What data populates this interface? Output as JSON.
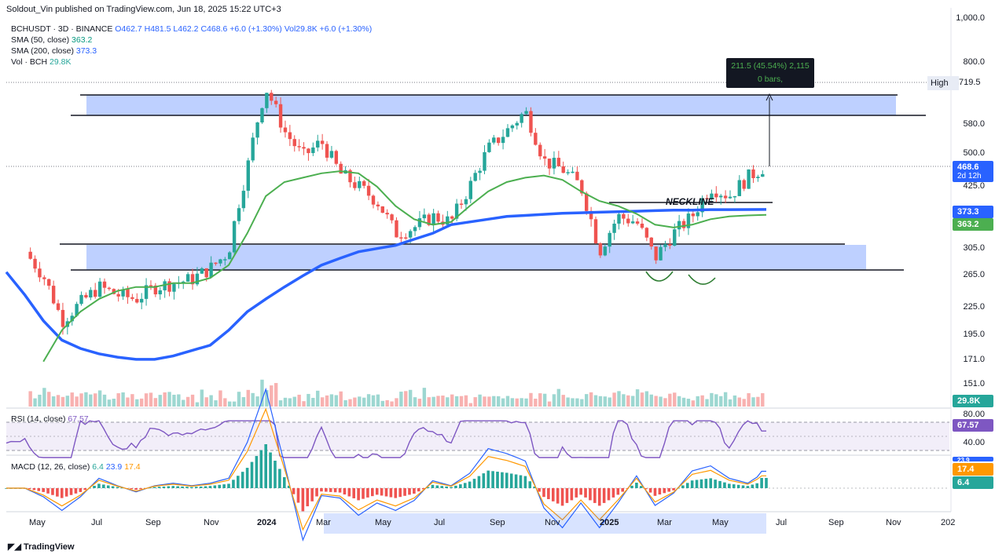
{
  "header": {
    "published": "Soldout_Vin published on TradingView.com, Jun 18, 2025 15:22 UTC+3",
    "symbol": "BCHUSDT · 3D · BINANCE",
    "ohlc": {
      "o": "O462.7",
      "h": "H481.5",
      "l": "L462.2",
      "c": "C468.6",
      "chg": "+6.0 (+1.30%)"
    },
    "vol_header": "Vol29.8K",
    "vol_chg": "+6.0 (+1.30%)"
  },
  "indicators": {
    "sma50": {
      "label": "SMA (50, close)",
      "value": "363.2",
      "color": "#4caf50"
    },
    "sma200": {
      "label": "SMA (200, close)",
      "value": "373.3",
      "color": "#2962ff"
    },
    "vol": {
      "label": "Vol · BCH",
      "value": "29.8K"
    }
  },
  "rsi": {
    "label": "RSI (14, close)",
    "value": "67.57",
    "axis": [
      "80.00",
      "40.00"
    ],
    "color": "#7e57c2"
  },
  "macd": {
    "label": "MACD (12, 26, close)",
    "v1": "6.4",
    "v2": "23.9",
    "v3": "17.4",
    "badge_signal": "17.4",
    "badge_hist": "6.4",
    "axis_top": "23.9"
  },
  "annotations": {
    "neckline": "NECKLINE",
    "measure_line1": "211.5 (45.54%) 2,115",
    "measure_line2": "0 bars,",
    "high_label": "High",
    "high_value": "719.5",
    "price_badge": "468.6",
    "price_timer": "2d 12h",
    "sma200_badge": "373.3",
    "sma50_badge": "363.2",
    "vol_badge": "29.8K",
    "rsi_badge": "67.57"
  },
  "colors": {
    "up": "#26a69a",
    "down": "#ef5350",
    "zone": "#2962ff",
    "sma50": "#4caf50",
    "sma200": "#2962ff",
    "rsi": "#7e57c2",
    "macd": "#2962ff",
    "signal": "#ff9800"
  },
  "footer": {
    "brand": "TradingView"
  },
  "chart_data": {
    "type": "line",
    "scale": "log",
    "price_axis": [
      "1,000.0",
      "800.0",
      "580.0",
      "500.0",
      "425.0",
      "305.0",
      "265.0",
      "225.0",
      "195.0",
      "171.0",
      "151.0"
    ],
    "price_axis_values": [
      1000,
      800,
      580,
      500,
      425,
      305,
      265,
      225,
      195,
      171,
      151
    ],
    "time_axis": [
      "May",
      "Jul",
      "Sep",
      "Nov",
      "2024",
      "Mar",
      "May",
      "Jul",
      "Sep",
      "Nov",
      "2025",
      "Mar",
      "May",
      "Jul",
      "Sep",
      "Nov",
      "202"
    ],
    "series": [
      {
        "name": "BCHUSDT",
        "points": [
          [
            0,
            null
          ],
          [
            1,
            300
          ],
          [
            2,
            265
          ],
          [
            3,
            210
          ],
          [
            4,
            230
          ],
          [
            5,
            250
          ],
          [
            6,
            240
          ],
          [
            7,
            235
          ],
          [
            8,
            250
          ],
          [
            9,
            255
          ],
          [
            10,
            260
          ],
          [
            11,
            275
          ],
          [
            12,
            300
          ],
          [
            13,
            460
          ],
          [
            14,
            700
          ],
          [
            15,
            560
          ],
          [
            16,
            490
          ],
          [
            17,
            530
          ],
          [
            18,
            450
          ],
          [
            19,
            420
          ],
          [
            20,
            390
          ],
          [
            21,
            330
          ],
          [
            22,
            340
          ],
          [
            23,
            360
          ],
          [
            24,
            350
          ],
          [
            25,
            420
          ],
          [
            26,
            510
          ],
          [
            27,
            560
          ],
          [
            28,
            620
          ],
          [
            29,
            480
          ],
          [
            30,
            460
          ],
          [
            31,
            420
          ],
          [
            32,
            300
          ],
          [
            33,
            360
          ],
          [
            34,
            350
          ],
          [
            35,
            290
          ],
          [
            36,
            330
          ],
          [
            37,
            360
          ],
          [
            38,
            420
          ],
          [
            39,
            400
          ],
          [
            40,
            440
          ],
          [
            41,
            469
          ]
        ]
      },
      {
        "name": "SMA (50, close)",
        "points": [
          [
            0,
            null
          ],
          [
            1,
            130
          ],
          [
            2,
            170
          ],
          [
            3,
            200
          ],
          [
            4,
            220
          ],
          [
            5,
            235
          ],
          [
            6,
            245
          ],
          [
            7,
            250
          ],
          [
            8,
            250
          ],
          [
            9,
            255
          ],
          [
            10,
            255
          ],
          [
            11,
            262
          ],
          [
            12,
            280
          ],
          [
            13,
            330
          ],
          [
            14,
            400
          ],
          [
            15,
            430
          ],
          [
            16,
            440
          ],
          [
            17,
            450
          ],
          [
            18,
            455
          ],
          [
            19,
            450
          ],
          [
            20,
            420
          ],
          [
            21,
            380
          ],
          [
            22,
            355
          ],
          [
            23,
            345
          ],
          [
            24,
            350
          ],
          [
            25,
            380
          ],
          [
            26,
            410
          ],
          [
            27,
            430
          ],
          [
            28,
            440
          ],
          [
            29,
            445
          ],
          [
            30,
            435
          ],
          [
            31,
            410
          ],
          [
            32,
            390
          ],
          [
            33,
            380
          ],
          [
            34,
            365
          ],
          [
            35,
            345
          ],
          [
            36,
            340
          ],
          [
            37,
            345
          ],
          [
            38,
            355
          ],
          [
            39,
            360
          ],
          [
            40,
            362
          ],
          [
            41,
            363.2
          ]
        ]
      },
      {
        "name": "SMA (200, close)",
        "points": [
          [
            0,
            270
          ],
          [
            1,
            240
          ],
          [
            2,
            210
          ],
          [
            3,
            190
          ],
          [
            4,
            182
          ],
          [
            5,
            177
          ],
          [
            6,
            174
          ],
          [
            7,
            172
          ],
          [
            8,
            172
          ],
          [
            9,
            175
          ],
          [
            10,
            180
          ],
          [
            11,
            185
          ],
          [
            12,
            200
          ],
          [
            13,
            220
          ],
          [
            14,
            235
          ],
          [
            15,
            250
          ],
          [
            16,
            265
          ],
          [
            17,
            280
          ],
          [
            18,
            290
          ],
          [
            19,
            300
          ],
          [
            20,
            305
          ],
          [
            21,
            310
          ],
          [
            22,
            320
          ],
          [
            23,
            330
          ],
          [
            24,
            345
          ],
          [
            25,
            350
          ],
          [
            26,
            355
          ],
          [
            27,
            360
          ],
          [
            28,
            362
          ],
          [
            29,
            364
          ],
          [
            30,
            366
          ],
          [
            31,
            367
          ],
          [
            32,
            368
          ],
          [
            33,
            369
          ],
          [
            34,
            370
          ],
          [
            35,
            371
          ],
          [
            36,
            372
          ],
          [
            37,
            372
          ],
          [
            38,
            373
          ],
          [
            39,
            373
          ],
          [
            40,
            373.2
          ],
          [
            41,
            373.3
          ]
        ]
      }
    ],
    "zones": [
      [
        305,
        265
      ],
      [
        719.5,
        580
      ]
    ],
    "rsi_last": 67.57,
    "macd_last": {
      "macd": 23.9,
      "signal": 17.4,
      "hist": 6.4
    }
  }
}
